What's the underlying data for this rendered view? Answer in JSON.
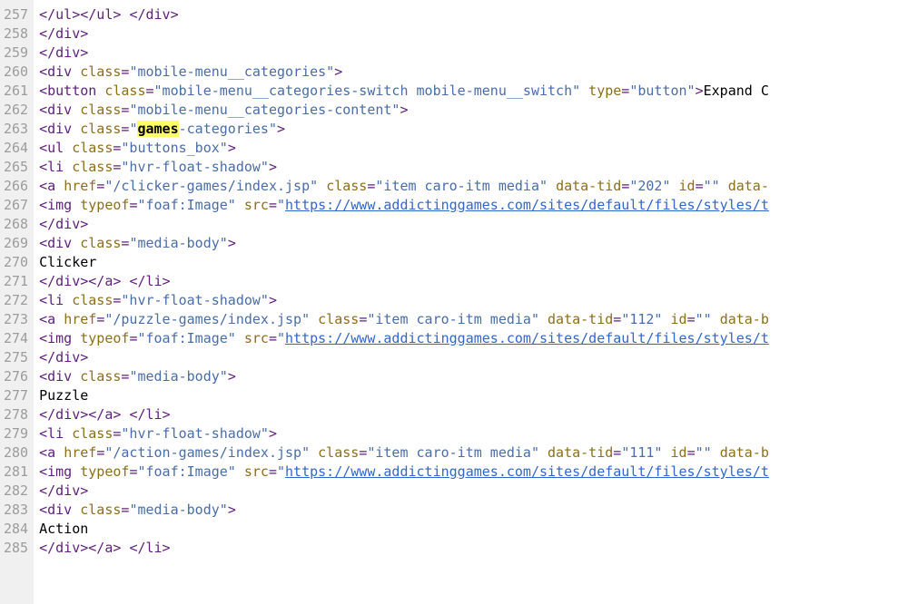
{
  "first_line_number": 257,
  "highlighted_term": "games",
  "lines": [
    {
      "tokens": [
        {
          "c": "t-tag",
          "t": "</ul></ul>"
        },
        {
          "c": "t-text",
          "t": " "
        },
        {
          "c": "t-tag",
          "t": "</div>"
        }
      ]
    },
    {
      "tokens": [
        {
          "c": "t-tag",
          "t": "</div>"
        }
      ]
    },
    {
      "tokens": [
        {
          "c": "t-tag",
          "t": "</div>"
        }
      ]
    },
    {
      "tokens": [
        {
          "c": "t-tag",
          "t": "<div "
        },
        {
          "c": "t-attr",
          "t": "class"
        },
        {
          "c": "t-tag",
          "t": "="
        },
        {
          "c": "t-str",
          "t": "\"mobile-menu__categories\""
        },
        {
          "c": "t-tag",
          "t": ">"
        }
      ]
    },
    {
      "tokens": [
        {
          "c": "t-tag",
          "t": "<button "
        },
        {
          "c": "t-attr",
          "t": "class"
        },
        {
          "c": "t-tag",
          "t": "="
        },
        {
          "c": "t-str",
          "t": "\"mobile-menu__categories-switch mobile-menu__switch\""
        },
        {
          "c": "t-tag",
          "t": " "
        },
        {
          "c": "t-attr",
          "t": "type"
        },
        {
          "c": "t-tag",
          "t": "="
        },
        {
          "c": "t-str",
          "t": "\"button\""
        },
        {
          "c": "t-tag",
          "t": ">"
        },
        {
          "c": "t-text",
          "t": "Expand C"
        }
      ]
    },
    {
      "tokens": [
        {
          "c": "t-tag",
          "t": "<div "
        },
        {
          "c": "t-attr",
          "t": "class"
        },
        {
          "c": "t-tag",
          "t": "="
        },
        {
          "c": "t-str",
          "t": "\"mobile-menu__categories-content\""
        },
        {
          "c": "t-tag",
          "t": ">"
        }
      ]
    },
    {
      "tokens": [
        {
          "c": "t-tag",
          "t": "<div "
        },
        {
          "c": "t-attr",
          "t": "class"
        },
        {
          "c": "t-tag",
          "t": "="
        },
        {
          "c": "t-str",
          "t": "\""
        },
        {
          "c": "hl",
          "t": "games"
        },
        {
          "c": "t-str",
          "t": "-categories\""
        },
        {
          "c": "t-tag",
          "t": ">"
        }
      ]
    },
    {
      "tokens": [
        {
          "c": "t-tag",
          "t": "<ul "
        },
        {
          "c": "t-attr",
          "t": "class"
        },
        {
          "c": "t-tag",
          "t": "="
        },
        {
          "c": "t-str",
          "t": "\"buttons_box\""
        },
        {
          "c": "t-tag",
          "t": ">"
        }
      ]
    },
    {
      "tokens": [
        {
          "c": "t-tag",
          "t": "<li "
        },
        {
          "c": "t-attr",
          "t": "class"
        },
        {
          "c": "t-tag",
          "t": "="
        },
        {
          "c": "t-str",
          "t": "\"hvr-float-shadow\""
        },
        {
          "c": "t-tag",
          "t": ">"
        }
      ]
    },
    {
      "tokens": [
        {
          "c": "t-tag",
          "t": "<a "
        },
        {
          "c": "t-attr",
          "t": "href"
        },
        {
          "c": "t-tag",
          "t": "="
        },
        {
          "c": "t-str",
          "t": "\"/clicker-games/index.jsp\""
        },
        {
          "c": "t-tag",
          "t": " "
        },
        {
          "c": "t-attr",
          "t": "class"
        },
        {
          "c": "t-tag",
          "t": "="
        },
        {
          "c": "t-str",
          "t": "\"item caro-itm media\""
        },
        {
          "c": "t-tag",
          "t": " "
        },
        {
          "c": "t-attr",
          "t": "data-tid"
        },
        {
          "c": "t-tag",
          "t": "="
        },
        {
          "c": "t-str",
          "t": "\"202\""
        },
        {
          "c": "t-tag",
          "t": " "
        },
        {
          "c": "t-attr",
          "t": "id"
        },
        {
          "c": "t-tag",
          "t": "="
        },
        {
          "c": "t-str",
          "t": "\"\""
        },
        {
          "c": "t-tag",
          "t": " "
        },
        {
          "c": "t-attr",
          "t": "data-"
        }
      ]
    },
    {
      "tokens": [
        {
          "c": "t-tag",
          "t": "<img "
        },
        {
          "c": "t-attr",
          "t": "typeof"
        },
        {
          "c": "t-tag",
          "t": "="
        },
        {
          "c": "t-str",
          "t": "\"foaf:Image\""
        },
        {
          "c": "t-tag",
          "t": " "
        },
        {
          "c": "t-attr",
          "t": "src"
        },
        {
          "c": "t-tag",
          "t": "="
        },
        {
          "c": "t-str",
          "t": "\""
        },
        {
          "c": "t-link",
          "t": "https://www.addictinggames.com/sites/default/files/styles/t"
        }
      ]
    },
    {
      "tokens": [
        {
          "c": "t-tag",
          "t": "</div>"
        }
      ]
    },
    {
      "tokens": [
        {
          "c": "t-tag",
          "t": "<div "
        },
        {
          "c": "t-attr",
          "t": "class"
        },
        {
          "c": "t-tag",
          "t": "="
        },
        {
          "c": "t-str",
          "t": "\"media-body\""
        },
        {
          "c": "t-tag",
          "t": ">"
        }
      ]
    },
    {
      "tokens": [
        {
          "c": "t-text",
          "t": "Clicker"
        }
      ]
    },
    {
      "tokens": [
        {
          "c": "t-tag",
          "t": "</div></a>"
        },
        {
          "c": "t-text",
          "t": " "
        },
        {
          "c": "t-tag",
          "t": "</li>"
        }
      ]
    },
    {
      "tokens": [
        {
          "c": "t-tag",
          "t": "<li "
        },
        {
          "c": "t-attr",
          "t": "class"
        },
        {
          "c": "t-tag",
          "t": "="
        },
        {
          "c": "t-str",
          "t": "\"hvr-float-shadow\""
        },
        {
          "c": "t-tag",
          "t": ">"
        }
      ]
    },
    {
      "tokens": [
        {
          "c": "t-tag",
          "t": "<a "
        },
        {
          "c": "t-attr",
          "t": "href"
        },
        {
          "c": "t-tag",
          "t": "="
        },
        {
          "c": "t-str",
          "t": "\"/puzzle-games/index.jsp\""
        },
        {
          "c": "t-tag",
          "t": " "
        },
        {
          "c": "t-attr",
          "t": "class"
        },
        {
          "c": "t-tag",
          "t": "="
        },
        {
          "c": "t-str",
          "t": "\"item caro-itm media\""
        },
        {
          "c": "t-tag",
          "t": " "
        },
        {
          "c": "t-attr",
          "t": "data-tid"
        },
        {
          "c": "t-tag",
          "t": "="
        },
        {
          "c": "t-str",
          "t": "\"112\""
        },
        {
          "c": "t-tag",
          "t": " "
        },
        {
          "c": "t-attr",
          "t": "id"
        },
        {
          "c": "t-tag",
          "t": "="
        },
        {
          "c": "t-str",
          "t": "\"\""
        },
        {
          "c": "t-tag",
          "t": " "
        },
        {
          "c": "t-attr",
          "t": "data-b"
        }
      ]
    },
    {
      "tokens": [
        {
          "c": "t-tag",
          "t": "<img "
        },
        {
          "c": "t-attr",
          "t": "typeof"
        },
        {
          "c": "t-tag",
          "t": "="
        },
        {
          "c": "t-str",
          "t": "\"foaf:Image\""
        },
        {
          "c": "t-tag",
          "t": " "
        },
        {
          "c": "t-attr",
          "t": "src"
        },
        {
          "c": "t-tag",
          "t": "="
        },
        {
          "c": "t-str",
          "t": "\""
        },
        {
          "c": "t-link",
          "t": "https://www.addictinggames.com/sites/default/files/styles/t"
        }
      ]
    },
    {
      "tokens": [
        {
          "c": "t-tag",
          "t": "</div>"
        }
      ]
    },
    {
      "tokens": [
        {
          "c": "t-tag",
          "t": "<div "
        },
        {
          "c": "t-attr",
          "t": "class"
        },
        {
          "c": "t-tag",
          "t": "="
        },
        {
          "c": "t-str",
          "t": "\"media-body\""
        },
        {
          "c": "t-tag",
          "t": ">"
        }
      ]
    },
    {
      "tokens": [
        {
          "c": "t-text",
          "t": "Puzzle"
        }
      ]
    },
    {
      "tokens": [
        {
          "c": "t-tag",
          "t": "</div></a>"
        },
        {
          "c": "t-text",
          "t": " "
        },
        {
          "c": "t-tag",
          "t": "</li>"
        }
      ]
    },
    {
      "tokens": [
        {
          "c": "t-tag",
          "t": "<li "
        },
        {
          "c": "t-attr",
          "t": "class"
        },
        {
          "c": "t-tag",
          "t": "="
        },
        {
          "c": "t-str",
          "t": "\"hvr-float-shadow\""
        },
        {
          "c": "t-tag",
          "t": ">"
        }
      ]
    },
    {
      "tokens": [
        {
          "c": "t-tag",
          "t": "<a "
        },
        {
          "c": "t-attr",
          "t": "href"
        },
        {
          "c": "t-tag",
          "t": "="
        },
        {
          "c": "t-str",
          "t": "\"/action-games/index.jsp\""
        },
        {
          "c": "t-tag",
          "t": " "
        },
        {
          "c": "t-attr",
          "t": "class"
        },
        {
          "c": "t-tag",
          "t": "="
        },
        {
          "c": "t-str",
          "t": "\"item caro-itm media\""
        },
        {
          "c": "t-tag",
          "t": " "
        },
        {
          "c": "t-attr",
          "t": "data-tid"
        },
        {
          "c": "t-tag",
          "t": "="
        },
        {
          "c": "t-str",
          "t": "\"111\""
        },
        {
          "c": "t-tag",
          "t": " "
        },
        {
          "c": "t-attr",
          "t": "id"
        },
        {
          "c": "t-tag",
          "t": "="
        },
        {
          "c": "t-str",
          "t": "\"\""
        },
        {
          "c": "t-tag",
          "t": " "
        },
        {
          "c": "t-attr",
          "t": "data-b"
        }
      ]
    },
    {
      "tokens": [
        {
          "c": "t-tag",
          "t": "<img "
        },
        {
          "c": "t-attr",
          "t": "typeof"
        },
        {
          "c": "t-tag",
          "t": "="
        },
        {
          "c": "t-str",
          "t": "\"foaf:Image\""
        },
        {
          "c": "t-tag",
          "t": " "
        },
        {
          "c": "t-attr",
          "t": "src"
        },
        {
          "c": "t-tag",
          "t": "="
        },
        {
          "c": "t-str",
          "t": "\""
        },
        {
          "c": "t-link",
          "t": "https://www.addictinggames.com/sites/default/files/styles/t"
        }
      ]
    },
    {
      "tokens": [
        {
          "c": "t-tag",
          "t": "</div>"
        }
      ]
    },
    {
      "tokens": [
        {
          "c": "t-tag",
          "t": "<div "
        },
        {
          "c": "t-attr",
          "t": "class"
        },
        {
          "c": "t-tag",
          "t": "="
        },
        {
          "c": "t-str",
          "t": "\"media-body\""
        },
        {
          "c": "t-tag",
          "t": ">"
        }
      ]
    },
    {
      "tokens": [
        {
          "c": "t-text",
          "t": "Action"
        }
      ]
    },
    {
      "tokens": [
        {
          "c": "t-tag",
          "t": "</div></a>"
        },
        {
          "c": "t-text",
          "t": " "
        },
        {
          "c": "t-tag",
          "t": "</li>"
        }
      ]
    }
  ]
}
